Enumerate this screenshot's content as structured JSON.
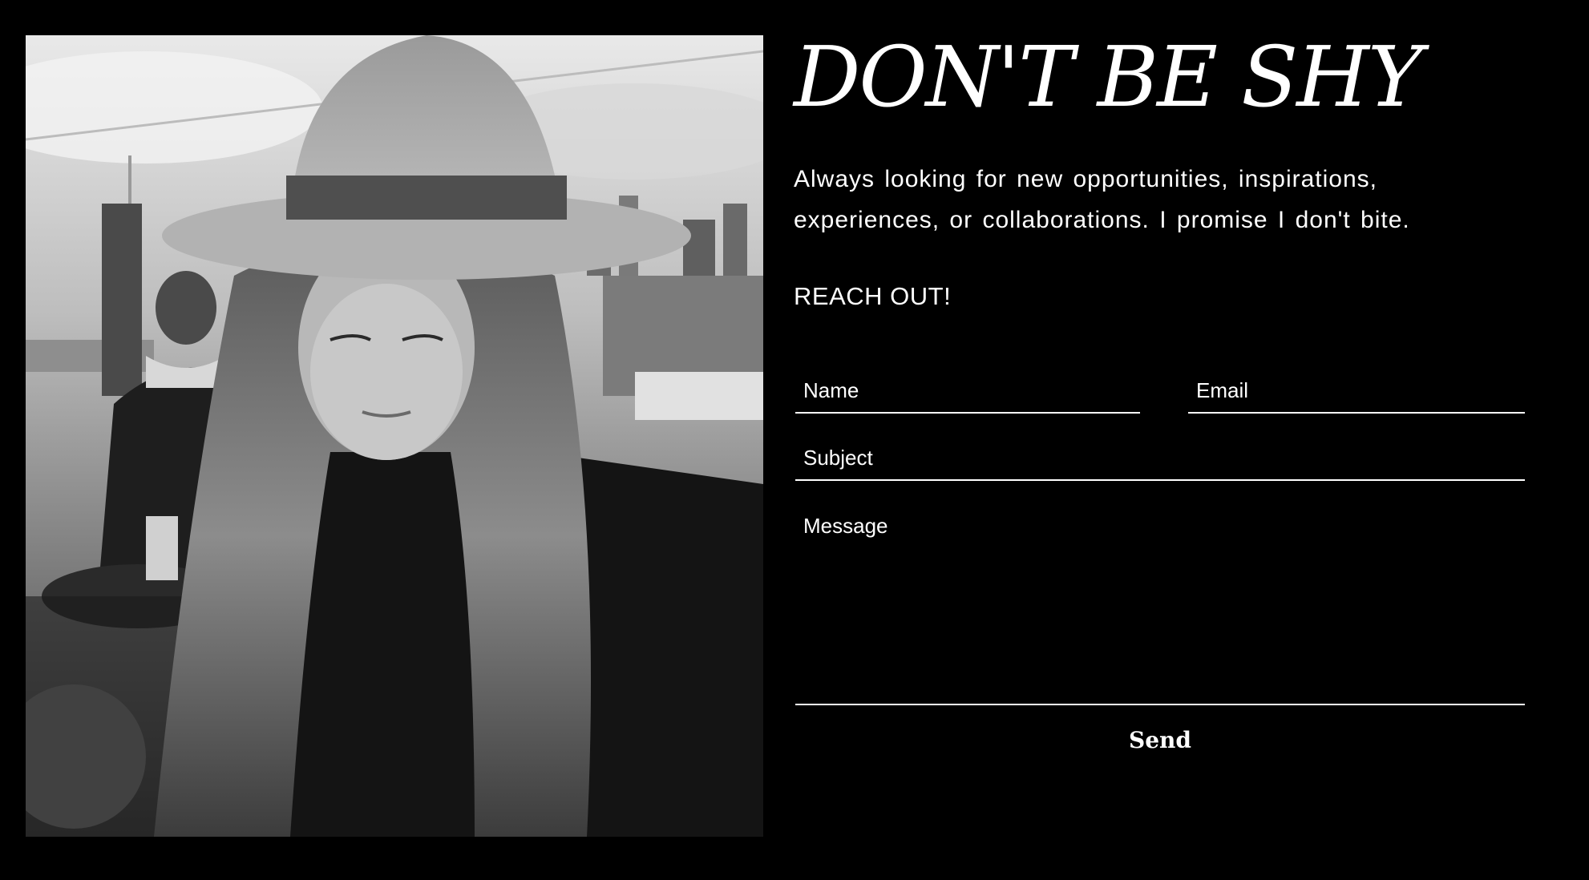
{
  "photo": {
    "description_icon": "portrait-photo"
  },
  "contact": {
    "heading": "DON'T BE SHY",
    "intro": "Always looking for new opportunities, inspirations, experiences, or collaborations. I promise I don't bite.",
    "subheading": "REACH OUT!",
    "form": {
      "name_placeholder": "Name",
      "email_placeholder": "Email",
      "subject_placeholder": "Subject",
      "message_placeholder": "Message",
      "send_label": "Send"
    }
  },
  "colors": {
    "background": "#000000",
    "text": "#ffffff",
    "field_underline": "#ffffff"
  }
}
